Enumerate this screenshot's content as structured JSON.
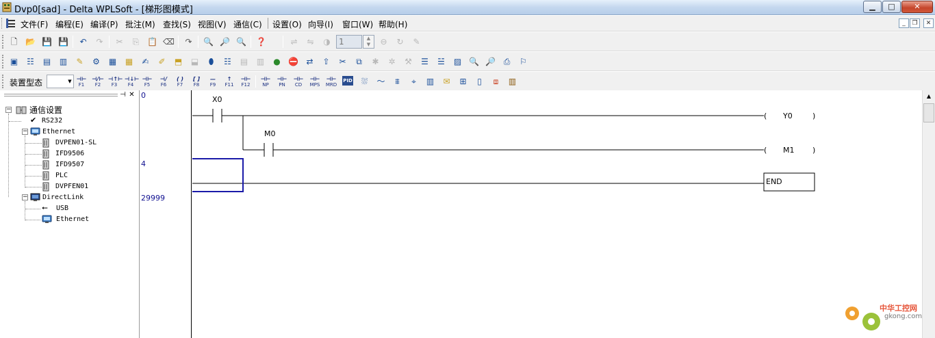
{
  "window": {
    "title": "Dvp0[sad] - Delta WPLSoft - [梯形图模式]",
    "min_label": "▁",
    "max_label": "□",
    "close_label": "✕"
  },
  "menu": {
    "items": [
      "文件(F)",
      "编程(E)",
      "编译(P)",
      "批注(M)",
      "查找(S)",
      "视图(V)",
      "通信(C)",
      "设置(O)",
      "向导(I)",
      "窗口(W)",
      "帮助(H)"
    ],
    "mdi_min": "_",
    "mdi_restore": "❐",
    "mdi_close": "✕"
  },
  "toolbar1": {
    "step_value": "1"
  },
  "toolbar3": {
    "device_label": "装置型态",
    "fkeys": [
      {
        "sym": "⊣⊢",
        "key": "F1"
      },
      {
        "sym": "⊣/⊢",
        "key": "F2"
      },
      {
        "sym": "⊣↑⊢",
        "key": "F3"
      },
      {
        "sym": "⊣↓⊢",
        "key": "F4"
      },
      {
        "sym": "⊣⊢",
        "key": "F5"
      },
      {
        "sym": "⊣/",
        "key": "F6"
      },
      {
        "sym": "( )",
        "key": "F7"
      },
      {
        "sym": "[ ]",
        "key": "F8"
      },
      {
        "sym": "—",
        "key": "F9"
      },
      {
        "sym": "↑",
        "key": "F11"
      },
      {
        "sym": "⊣⊢",
        "key": "F12"
      }
    ],
    "extra_keys": [
      "NP",
      "PN",
      "CD",
      "MPS",
      "MRD",
      "PID"
    ]
  },
  "tree": {
    "root": "通信设置",
    "rs232": "RS232",
    "ethernet": "Ethernet",
    "ethernet_children": [
      "DVPEN01-SL",
      "IFD9506",
      "IFD9507",
      "PLC",
      "DVPFEN01"
    ],
    "directlink": "DirectLink",
    "directlink_children": [
      "USB",
      "Ethernet"
    ]
  },
  "lines": [
    "0",
    "4",
    "29999"
  ],
  "ladder": {
    "rung1_contact": "X0",
    "rung1_coil": "Y0",
    "rung2_contact": "M0",
    "rung2_coil": "M1",
    "end_label": "END"
  },
  "watermark": {
    "name": "中华工控网",
    "url": "gkong.com"
  },
  "colors": {
    "cursor": "#1a1aa8",
    "line_numbers": "#101090"
  }
}
